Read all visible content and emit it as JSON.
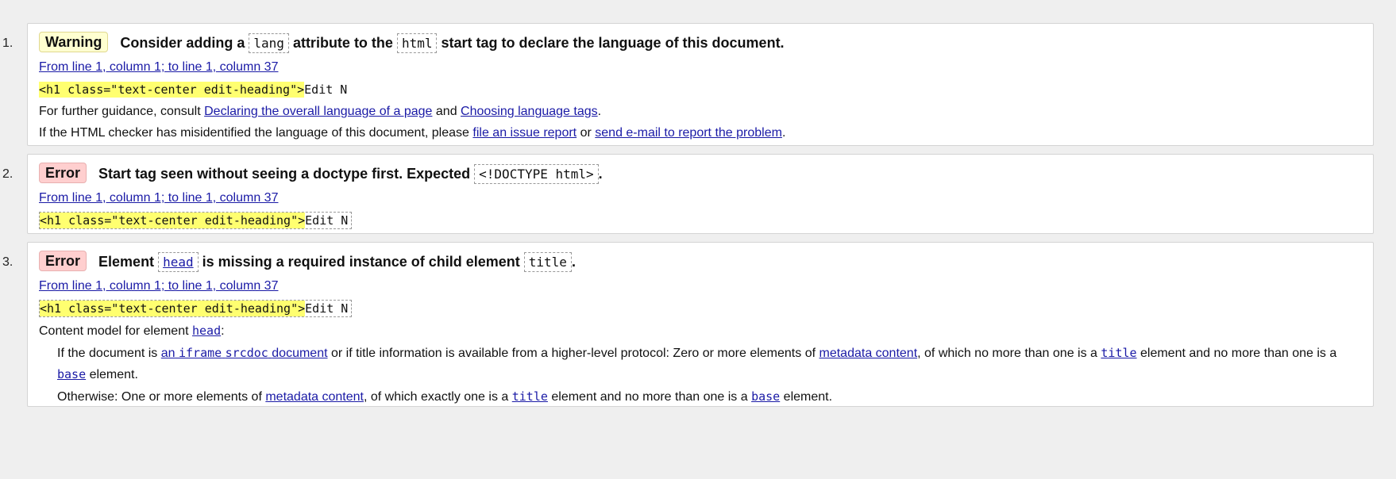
{
  "messages": [
    {
      "number": "1.",
      "type": "Warning",
      "text_parts": [
        "Consider adding a",
        "lang",
        "attribute to the",
        "html",
        "start tag to declare the language of this document."
      ],
      "location": "From line 1, column 1; to line 1, column 37",
      "extract_highlight": "<h1 class=\"text-center edit-heading\">",
      "extract_rest": "Edit N",
      "guidance_prefix": "For further guidance, consult",
      "guidance_link1": "Declaring the overall language of a page",
      "guidance_and": "and",
      "guidance_link2": "Choosing language tags",
      "guidance_end": ".",
      "misid_prefix": "If the HTML checker has misidentified the language of this document, please",
      "misid_link1": "file an issue report",
      "misid_or": "or",
      "misid_link2": "send e-mail to report the problem",
      "misid_end": "."
    },
    {
      "number": "2.",
      "type": "Error",
      "text_parts": [
        "Start tag seen without seeing a doctype first. Expected",
        "<!DOCTYPE html>",
        "."
      ],
      "location": "From line 1, column 1; to line 1, column 37",
      "extract_highlight": "<h1 class=\"text-center edit-heading\">",
      "extract_rest": "Edit N"
    },
    {
      "number": "3.",
      "type": "Error",
      "text_parts": [
        "Element",
        "head",
        "is missing a required instance of child element",
        "title",
        "."
      ],
      "location": "From line 1, column 1; to line 1, column 37",
      "extract_highlight": "<h1 class=\"text-center edit-heading\">",
      "extract_rest": "Edit N",
      "model_prefix": "Content model for element",
      "model_element": "head",
      "model_colon": ":",
      "model_line1": {
        "a": "If the document is",
        "link_pre": "an",
        "link_code": "iframe",
        "link_code2": "srcdoc",
        "link_post": "document",
        "b": "or if title information is available from a higher-level protocol: Zero or more elements of",
        "link_meta": "metadata content",
        "c": ", of which no more than one is a",
        "title": "title",
        "d": "element and no more than one is a",
        "base": "base",
        "e": "element."
      },
      "model_line2": {
        "a": "Otherwise: One or more elements of",
        "link_meta": "metadata content",
        "b": ", of which exactly one is a",
        "title": "title",
        "c": "element and no more than one is a",
        "base": "base",
        "d": "element."
      }
    }
  ]
}
